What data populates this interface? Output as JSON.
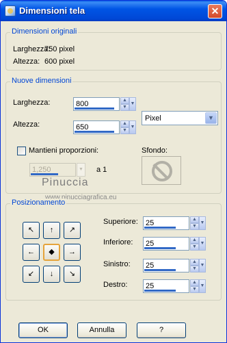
{
  "window": {
    "title": "Dimensioni tela",
    "close_glyph": "✕"
  },
  "original": {
    "legend": "Dimensioni originali",
    "width_label": "Larghezza:",
    "width_value": "750 pixel",
    "height_label": "Altezza:",
    "height_value": "600 pixel"
  },
  "new_dims": {
    "legend": "Nuove dimensioni",
    "width_label": "Larghezza:",
    "width_value": "800",
    "height_label": "Altezza:",
    "height_value": "650",
    "unit": "Pixel",
    "keep_ratio_label": "Mantieni proporzioni:",
    "ratio_value": "1,250",
    "ratio_suffix": "a 1",
    "background_label": "Sfondo:"
  },
  "watermark": {
    "line1": "Pinuccia",
    "line2": "www.pinucciagrafica.eu"
  },
  "position": {
    "legend": "Posizionamento",
    "top_label": "Superiore:",
    "top_value": "25",
    "bottom_label": "Inferiore:",
    "bottom_value": "25",
    "left_label": "Sinistro:",
    "left_value": "25",
    "right_label": "Destro:",
    "right_value": "25",
    "anchors": [
      "↖",
      "↑",
      "↗",
      "←",
      "◆",
      "→",
      "↙",
      "↓",
      "↘"
    ]
  },
  "buttons": {
    "ok": "OK",
    "cancel": "Annulla",
    "help": "?"
  },
  "colors": {
    "accent": "#0046d5",
    "titlebar": "#0055e5",
    "selected_border": "#e5a33a"
  }
}
